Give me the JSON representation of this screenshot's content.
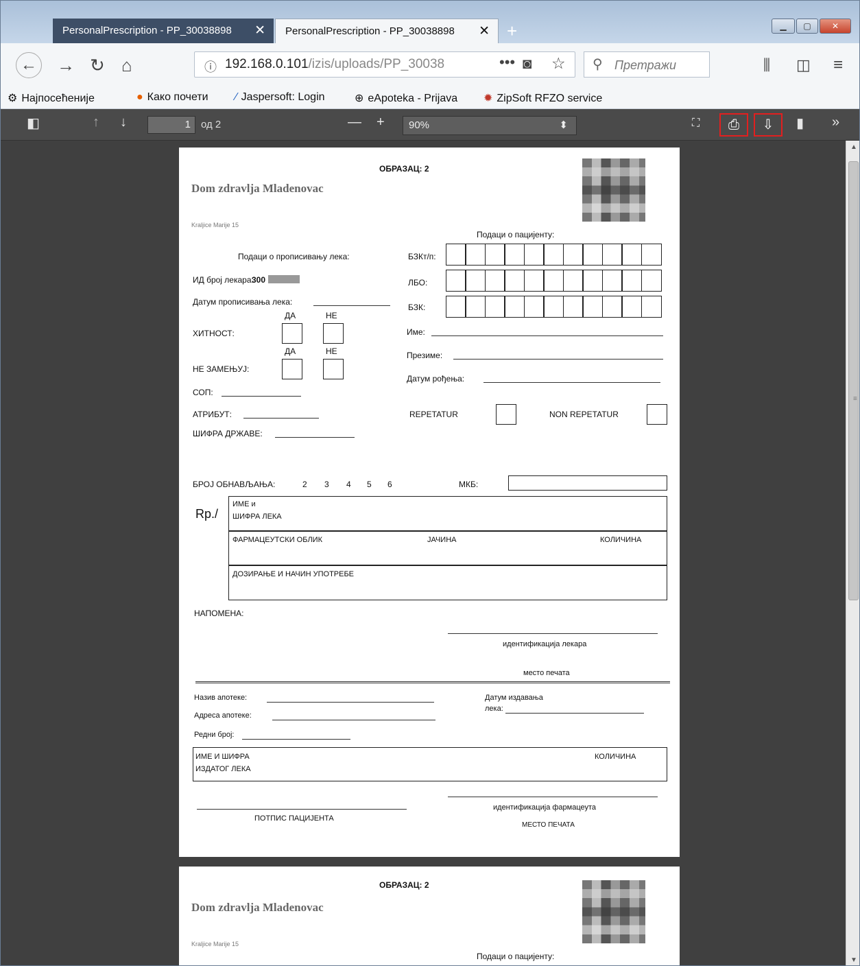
{
  "browser": {
    "tabs": [
      {
        "label": "PersonalPrescription - PP_30038898",
        "close": "✕"
      },
      {
        "label": "PersonalPrescription - PP_30038898",
        "close": "✕"
      }
    ],
    "new_tab": "+",
    "url": {
      "host": "192.168.0.101",
      "path": "/izis/uploads/PP_30038"
    },
    "search_placeholder": "Претражи",
    "bookmarks": [
      "Најпосећеније",
      "Како почети",
      "Jaspersoft: Login",
      "eApoteka - Prijava",
      "ZipSoft RFZO service"
    ]
  },
  "pdf_toolbar": {
    "page_number": "1",
    "page_count": "од 2",
    "zoom": "90%"
  },
  "form": {
    "title": "ОБРАЗАЦ: 2",
    "institution": "Dom zdravlja Mladenovac",
    "address": "Kraljice Marije 15",
    "patient_section": "Подаци о пацијенту:",
    "rx_section": "Подаци о прописивању лека:",
    "doctor_id_label": "ИД број лекара:",
    "doctor_id_value": "300",
    "rx_date_label": "Датум прописивања лека:",
    "yes": "ДА",
    "no": "НЕ",
    "urgency": "ХИТНОСТ:",
    "no_substitute": "НЕ ЗАМЕЊУЈ:",
    "sop": "СОП:",
    "attribute": "АТРИБУТ:",
    "country_code": "ШИФРА ДРЖАВЕ:",
    "bzk_tp": "БЗКт/п:",
    "lbo": "ЛБО:",
    "bzk": "БЗК:",
    "name": "Име:",
    "surname": "Презиме:",
    "dob": "Датум рођења:",
    "repetatur": "REPETATUR",
    "non_repetatur": "NON REPETATUR",
    "renewals_label": "БРОЈ ОБНАВЉАЊА:",
    "renewals": [
      "2",
      "3",
      "4",
      "5",
      "6"
    ],
    "mkb": "МКБ:",
    "rp": "Rp./",
    "drug_name_1": "ИМЕ и",
    "drug_name_2": "ШИФРА ЛЕКА",
    "pharm_form": "ФАРМАЦЕУТСКИ ОБЛИК",
    "strength": "ЈАЧИНА",
    "quantity": "КОЛИЧИНА",
    "dosing": "ДОЗИРАЊЕ И НАЧИН УПОТРЕБЕ",
    "note": "НАПОМЕНА:",
    "doctor_ident": "идентификација лекара",
    "stamp_place": "место печата",
    "pharmacy_name": "Назив апотеке:",
    "pharmacy_address": "Адреса апотеке:",
    "issue_date_1": "Датум издавања",
    "issue_date_2": "лека:",
    "serial": "Редни број:",
    "issued_1": "ИМЕ И ШИФРА",
    "issued_2": "ИЗДАТОГ ЛЕКА",
    "issued_qty": "КОЛИЧИНА",
    "patient_sign": "ПОТПИС ПАЦИЈЕНТА",
    "pharmacist_ident": "идентификација фармацеута",
    "stamp_place_upper": "МЕСТО ПЕЧАТА"
  },
  "colors": {
    "highlight": "#e21f1f",
    "viewer_bg": "#404040",
    "toolbar_bg": "#4a4a4a"
  }
}
